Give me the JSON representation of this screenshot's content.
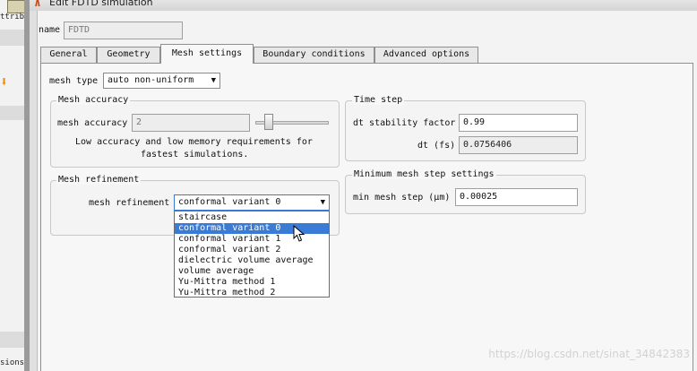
{
  "background_window": {
    "top_text": "ttrib",
    "bottom_text": "sions",
    "arrow_color": "#f08a10"
  },
  "dialog": {
    "title": "Edit FDTD simulation",
    "name_label": "name",
    "name_value": "FDTD"
  },
  "tabs": [
    {
      "label": "General",
      "active": false
    },
    {
      "label": "Geometry",
      "active": false
    },
    {
      "label": "Mesh settings",
      "active": true
    },
    {
      "label": "Boundary conditions",
      "active": false
    },
    {
      "label": "Advanced options",
      "active": false
    }
  ],
  "mesh_type": {
    "label": "mesh type",
    "value": "auto non-uniform"
  },
  "mesh_accuracy": {
    "group_title": "Mesh accuracy",
    "label": "mesh accuracy",
    "value": "2",
    "slider_level": 2,
    "note_line1": "Low accuracy and low memory requirements for",
    "note_line2": "fastest simulations."
  },
  "mesh_refinement": {
    "group_title": "Mesh refinement",
    "label": "mesh refinement",
    "value": "conformal variant 0",
    "options": [
      "staircase",
      "conformal variant 0",
      "conformal variant 1",
      "conformal variant 2",
      "dielectric volume average",
      "volume average",
      "Yu-Mittra method 1",
      "Yu-Mittra method 2"
    ],
    "selected_index": 1
  },
  "time_step": {
    "group_title": "Time step",
    "dt_stability_label": "dt stability factor",
    "dt_stability_value": "0.99",
    "dt_label": "dt (fs)",
    "dt_value": "0.0756406"
  },
  "min_mesh": {
    "group_title": "Minimum mesh step settings",
    "label": "min mesh step (μm)",
    "value": "0.00025"
  },
  "watermark": "https://blog.csdn.net/sinat_34842383",
  "colors": {
    "selection": "#3a7bd5",
    "title_icon": "#c34b17"
  }
}
